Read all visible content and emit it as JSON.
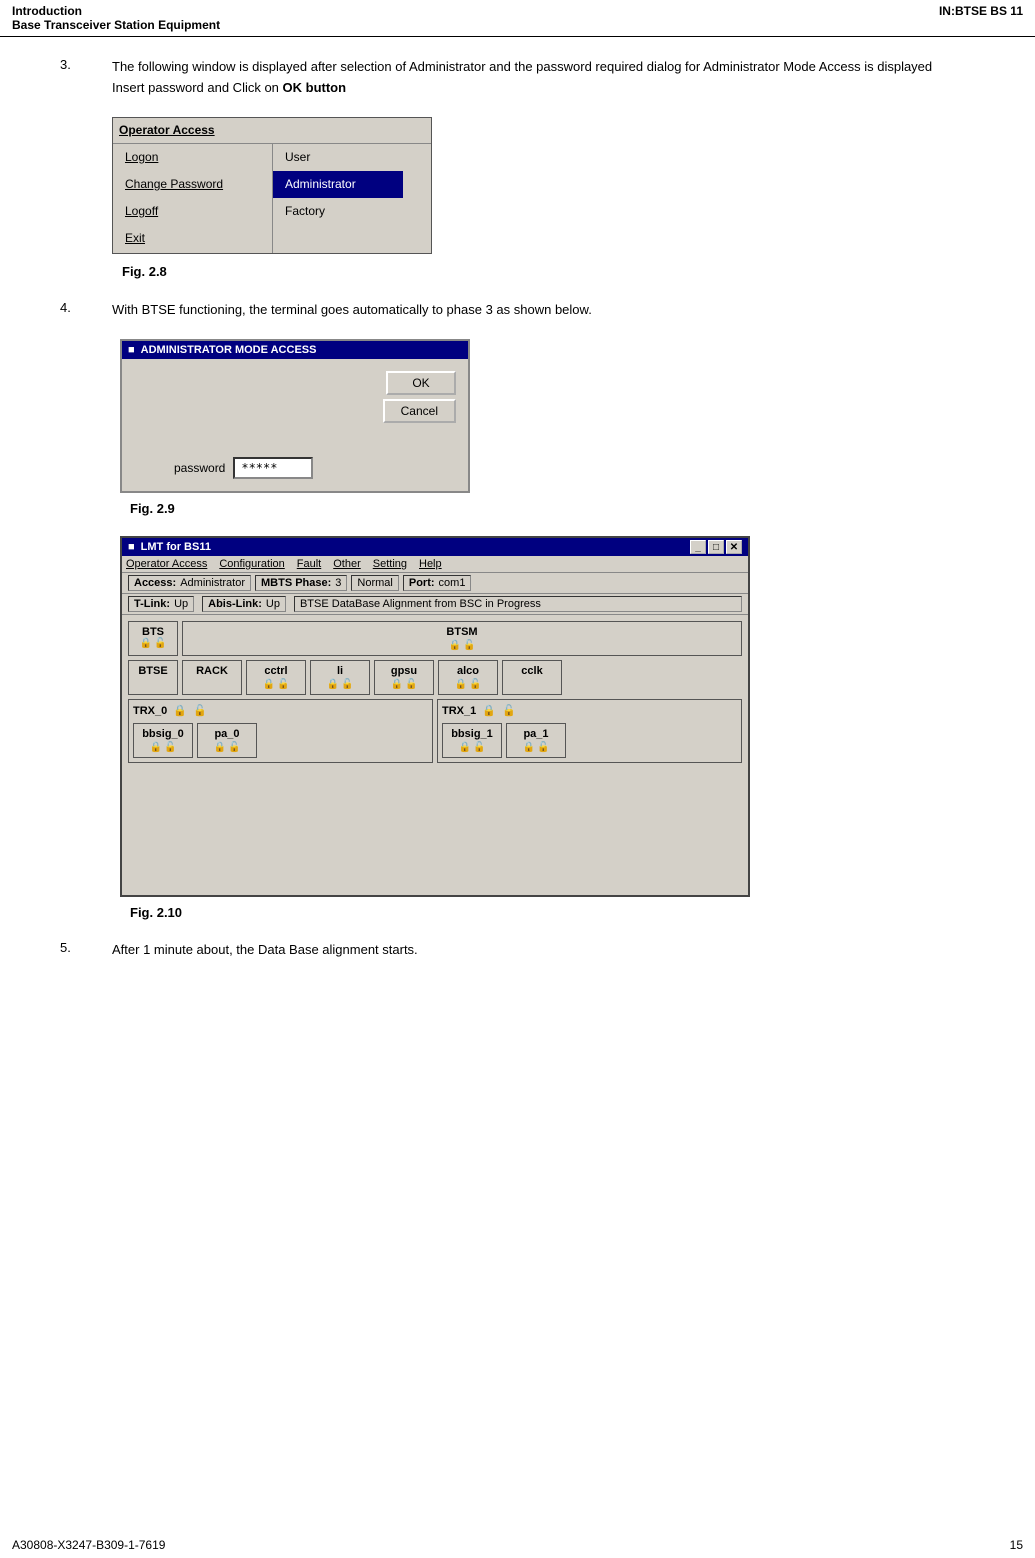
{
  "header": {
    "left_title": "Introduction",
    "left_subtitle": "Base Transceiver Station Equipment",
    "right_title": "IN:BTSE BS 11"
  },
  "footer": {
    "left": "A30808-X3247-B309-1-7619",
    "right": "15"
  },
  "fig28": {
    "title": "Operator Access",
    "menu_items": [
      "Logon",
      "Change Password",
      "Logoff",
      "Exit"
    ],
    "sub_items": [
      "User",
      "Administrator",
      "Factory"
    ],
    "selected": "Administrator",
    "label": "Fig.  2.8"
  },
  "fig29": {
    "title": "ADMINISTRATOR MODE ACCESS",
    "titlebar_icon": "■",
    "ok_btn": "OK",
    "cancel_btn": "Cancel",
    "password_label": "password",
    "password_value": "*****",
    "label": "Fig.  2.9"
  },
  "step3": {
    "number": "3.",
    "text1": "The following window is displayed after selection of Administrator and the password required dialog for Administrator Mode Access is displayed",
    "text2": "Insert password and Click on ",
    "text2_bold": "OK button"
  },
  "step4": {
    "number": "4.",
    "text": "With BTSE functioning, the terminal goes automatically to phase 3 as shown below."
  },
  "step5": {
    "number": "5.",
    "text": "After 1 minute about, the Data Base alignment starts."
  },
  "fig210": {
    "title": "LMT  for  BS11",
    "titlebar_icon": "■",
    "ctrl_minimize": "_",
    "ctrl_maximize": "□",
    "ctrl_close": "✕",
    "menu_items": [
      "Operator Access",
      "Configuration",
      "Fault",
      "Other",
      "Setting",
      "Help"
    ],
    "status_bar": {
      "access_label": "Access:",
      "access_value": "Administrator",
      "mbts_label": "MBTS Phase:",
      "mbts_value": "3",
      "normal_value": "Normal",
      "port_label": "Port:",
      "port_value": "com1"
    },
    "link_bar": {
      "tlink_label": "T-Link:",
      "tlink_value": "Up",
      "abis_label": "Abis-Link:",
      "abis_value": "Up",
      "db_text": "BTSE DataBase Alignment from BSC in Progress"
    },
    "equipment": {
      "bts_label": "BTS",
      "btsm_label": "BTSM",
      "btse_label": "BTSE",
      "rack_label": "RACK",
      "components": [
        "cctrl",
        "li",
        "gpsu",
        "alco",
        "cclk"
      ],
      "trx0_label": "TRX_0",
      "trx1_label": "TRX_1",
      "bbsig0": "bbsig_0",
      "bbsig1": "bbsig_1",
      "pa0": "pa_0",
      "pa1": "pa_1"
    },
    "label": "Fig.  2.10"
  }
}
